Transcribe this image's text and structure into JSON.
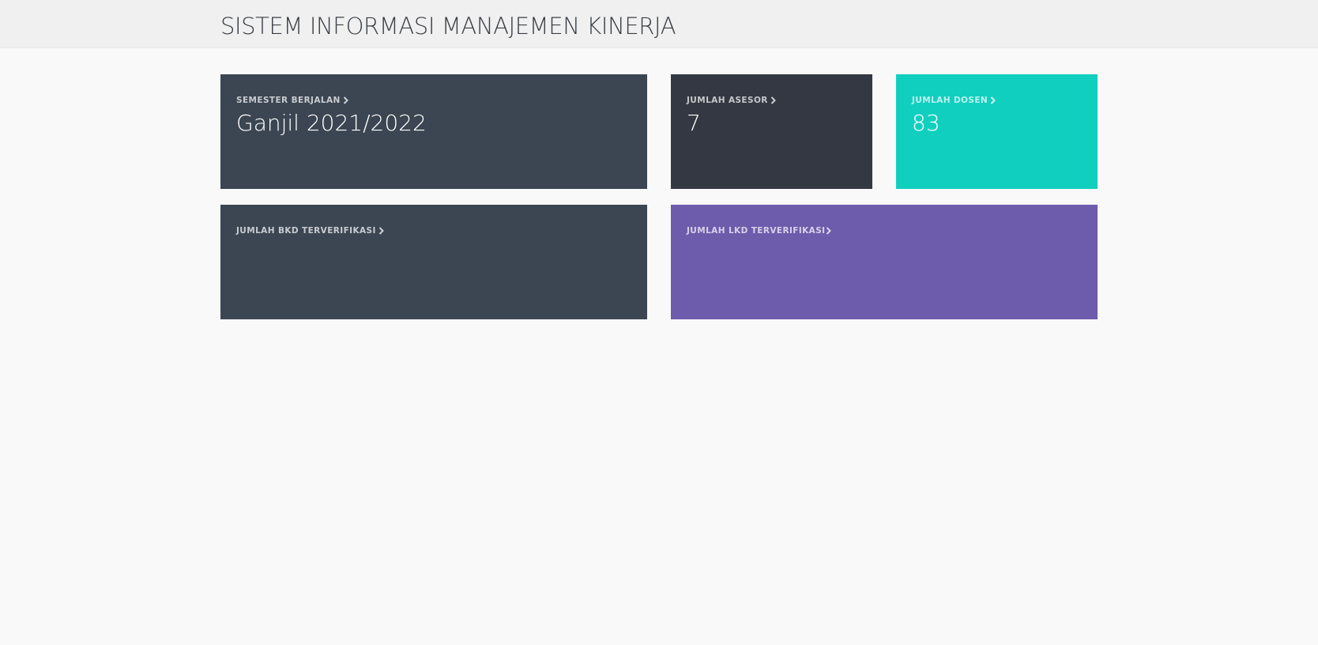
{
  "header": {
    "title": "SISTEM INFORMASI MANAJEMEN KINERJA"
  },
  "tiles": {
    "semester": {
      "label": "SEMESTER BERJALAN",
      "value": "Ganjil 2021/2022",
      "color": "#3b4652",
      "icon": "chevron-right-icon"
    },
    "asesor": {
      "label": "JUMLAH ASESOR",
      "value": "7",
      "color": "#343842",
      "icon": "chevron-right-icon"
    },
    "dosen": {
      "label": "JUMLAH DOSEN",
      "value": "83",
      "color": "#11cfbf",
      "icon": "chevron-right-icon"
    },
    "bkd": {
      "label": "JUMLAH BKD TERVERIFIKASI",
      "value": "",
      "color": "#3b4652",
      "icon": "chevron-right-icon"
    },
    "lkd": {
      "label": "JUMLAH LKD TERVERIFIKASI",
      "value": "",
      "color": "#6d5bac",
      "icon": "chevron-right-icon"
    }
  }
}
